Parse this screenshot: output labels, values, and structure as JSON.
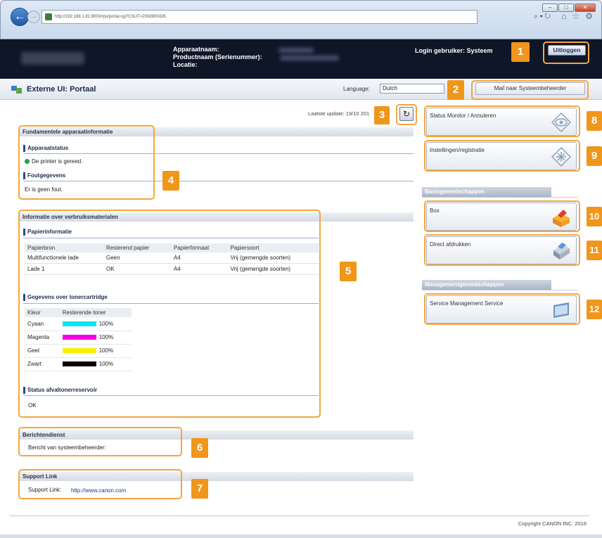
{
  "browser": {
    "url": "http://192.168.1.81:8000/rps/portal.cgi?CSUT=200d900d26",
    "search_glyph": "⌕ ▾ ↻",
    "window_controls": [
      "–",
      "□",
      "✕"
    ],
    "toolbar_icons": [
      "⌂",
      "☆",
      "⚙"
    ]
  },
  "header": {
    "device_labels": [
      "Apparaatnaam:",
      "Productnaam (Serienummer):",
      "Locatie:"
    ],
    "login_user": "Login gebruiker: Systeem",
    "logout_label": "Uitloggen"
  },
  "portal": {
    "title": "Externe UI: Portaal",
    "language_label": "Language:",
    "language_value": "Dutch",
    "mail_label": "Mail naar Systeembeheerder"
  },
  "update": {
    "label": "Laatste update: 19/10 201",
    "refresh_icon": "↻"
  },
  "basic_info": {
    "title": "Fundamentele apparaatinformatie",
    "status_heading": "Apparaatstatus",
    "status_text": "De printer is gereed.",
    "error_heading": "Foutgegevens",
    "error_text": "Er is geen fout."
  },
  "consumables": {
    "title": "Informatie over verbruiksmaterialen",
    "paper_heading": "Papierinformatie",
    "paper_columns": [
      "Papierbron",
      "Resterend papier",
      "Papierformaat",
      "Papiersoort"
    ],
    "paper_rows": [
      [
        "Multifunctionele lade",
        "Geen",
        "A4",
        "Vrij (gemengde soorten)"
      ],
      [
        "Lade 1",
        "OK",
        "A4",
        "Vrij (gemengde soorten)"
      ]
    ],
    "toner_heading": "Gegevens over tonercartridge",
    "toner_columns": [
      "Kleur",
      "Resterende toner"
    ],
    "toner_rows": [
      {
        "color": "Cyaan",
        "value": "100%",
        "swatch": "#00e5f0",
        "level": 1.0
      },
      {
        "color": "Magenta",
        "value": "100%",
        "swatch": "#f000e0",
        "level": 1.0
      },
      {
        "color": "Geel",
        "value": "100%",
        "swatch": "#f7f000",
        "level": 1.0
      },
      {
        "color": "Zwart",
        "value": "100%",
        "swatch": "#000000",
        "level": 1.0
      }
    ],
    "waste_heading": "Status afvaltonerreservoir",
    "waste_text": "OK"
  },
  "message": {
    "title": "Berichtendienst",
    "text": "Bericht van systeembeheerder:"
  },
  "support": {
    "title": "Support Link",
    "label": "Support Link:",
    "url": "http://www.canon.com"
  },
  "right_panel": {
    "status_monitor": "Status Monitor / Annuleren",
    "settings": "Instellingen/registratie",
    "basic_tools_heading": "Basisgereedschappen",
    "box": "Box",
    "direct_print": "Direct afdrukken",
    "management_heading": "Managementgereedschappen",
    "sms": "Service Management Service"
  },
  "callouts": [
    "1",
    "2",
    "3",
    "4",
    "5",
    "6",
    "7",
    "8",
    "9",
    "10",
    "11",
    "12"
  ],
  "footer": {
    "copyright": "Copyright CANON INC. 2016"
  },
  "colors": {
    "callout_orange": "#f0961b",
    "header_dark": "#0e1628"
  }
}
